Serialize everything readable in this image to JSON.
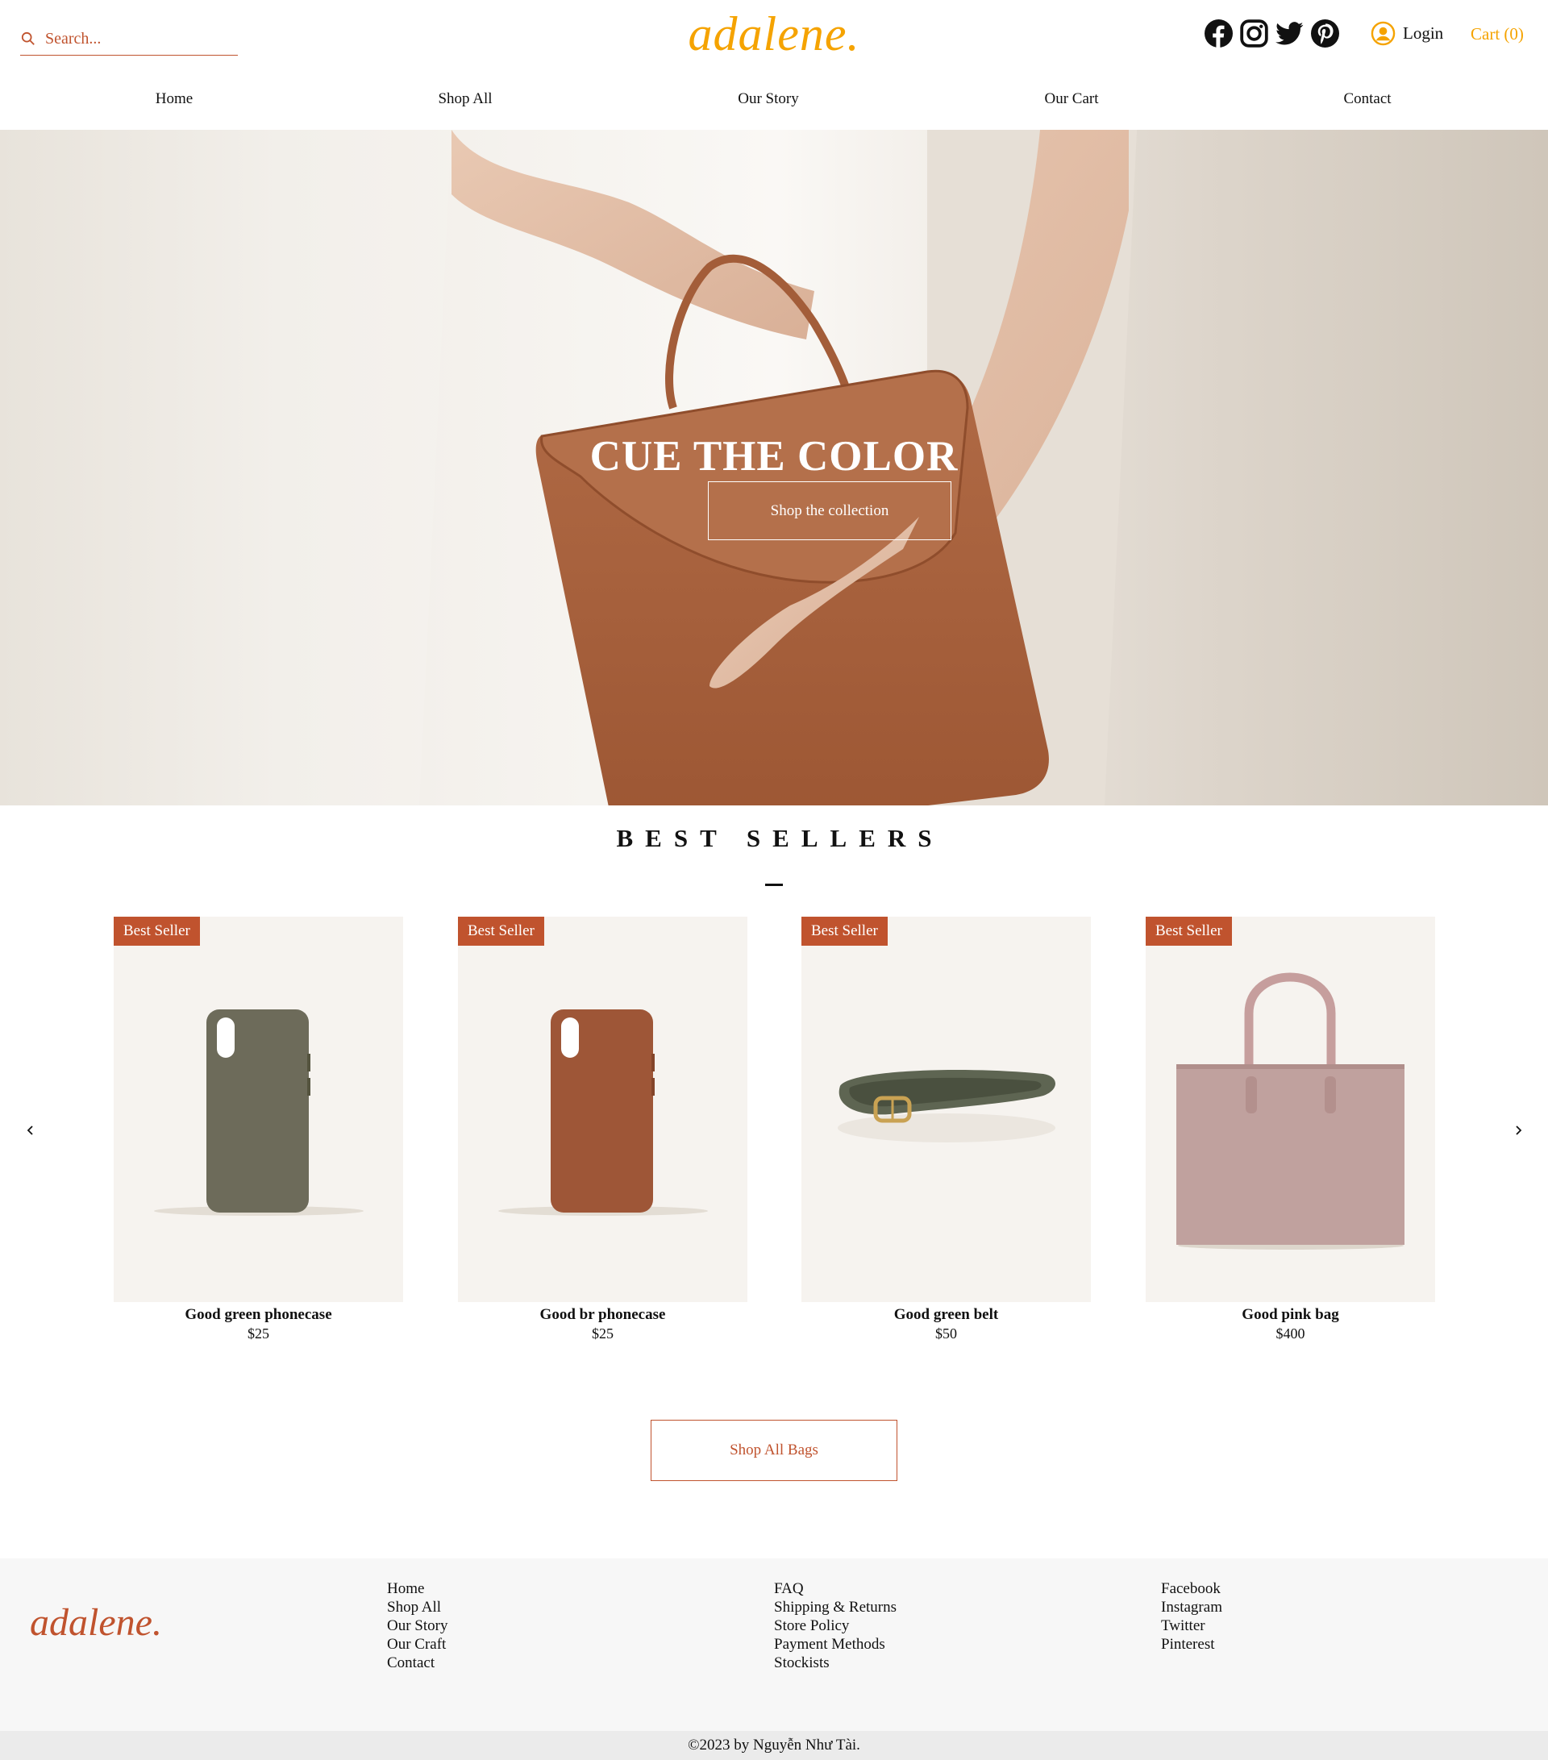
{
  "header": {
    "search_placeholder": "Search...",
    "logo": "adalene.",
    "social_icons": [
      "facebook-icon",
      "instagram-icon",
      "twitter-icon",
      "pinterest-icon"
    ],
    "login_label": "Login",
    "cart_label": "Cart (0)"
  },
  "nav": {
    "items": [
      "Home",
      "Shop All",
      "Our Story",
      "Our Cart",
      "Contact"
    ]
  },
  "hero": {
    "title": "CUE THE COLOR",
    "button_label": "Shop the collection"
  },
  "best_sellers": {
    "title": "BEST SELLERS",
    "badge": "Best Seller",
    "products": [
      {
        "name": "Good green phonecase",
        "price": "$25",
        "color": "#6d6b5a"
      },
      {
        "name": "Good br phonecase",
        "price": "$25",
        "color": "#9e5637"
      },
      {
        "name": "Good green belt",
        "price": "$50",
        "color": "#5e6552"
      },
      {
        "name": "Good pink bag",
        "price": "$400",
        "color": "#c0a19e"
      }
    ],
    "shop_all_label": "Shop All Bags"
  },
  "footer": {
    "logo": "adalene.",
    "col1": [
      "Home",
      "Shop All",
      "Our Story",
      "Our Craft",
      "Contact"
    ],
    "col2": [
      "FAQ",
      "Shipping & Returns",
      "Store Policy",
      "Payment Methods",
      "Stockists"
    ],
    "col3": [
      "Facebook",
      "Instagram",
      "Twitter",
      "Pinterest"
    ],
    "copyright": "©2023 by Nguyễn Như Tài."
  },
  "colors": {
    "accent_orange": "#f5a300",
    "brand_rust": "#c0532e",
    "footer_bg": "#f7f7f7"
  }
}
